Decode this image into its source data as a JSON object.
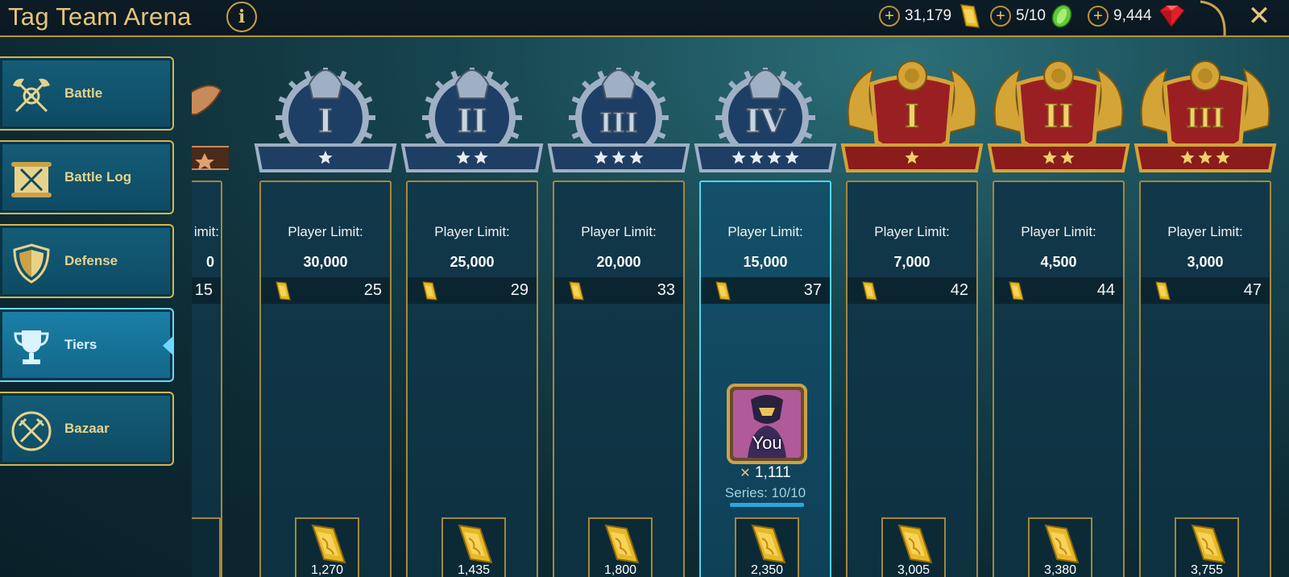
{
  "header": {
    "title": "Tag Team Arena",
    "info_icon": "info-icon",
    "close_icon": "close-icon"
  },
  "resources": [
    {
      "value": "31,179",
      "icon": "gold-bar-icon"
    },
    {
      "value": "5/10",
      "icon": "arena-token-icon"
    },
    {
      "value": "9,444",
      "icon": "gem-icon"
    }
  ],
  "sidebar": {
    "items": [
      {
        "label": "Battle",
        "icon": "crossed-axes-icon",
        "active": false
      },
      {
        "label": "Battle Log",
        "icon": "scroll-swords-icon",
        "active": false
      },
      {
        "label": "Defense",
        "icon": "shield-icon",
        "active": false
      },
      {
        "label": "Tiers",
        "icon": "trophy-icon",
        "active": true
      },
      {
        "label": "Bazaar",
        "icon": "crossed-swords-icon",
        "active": false
      }
    ]
  },
  "tiers": {
    "partial": {
      "label_tail": "imit:",
      "value_tail": "0",
      "medals": "15"
    },
    "columns": [
      {
        "label": "Player Limit:",
        "limit": "30,000",
        "medals": "25",
        "reward": "1,270",
        "rank": "I",
        "stars": 1,
        "tier": "silver",
        "current": false
      },
      {
        "label": "Player Limit:",
        "limit": "25,000",
        "medals": "29",
        "reward": "1,435",
        "rank": "II",
        "stars": 2,
        "tier": "silver",
        "current": false
      },
      {
        "label": "Player Limit:",
        "limit": "20,000",
        "medals": "33",
        "reward": "1,800",
        "rank": "III",
        "stars": 3,
        "tier": "silver",
        "current": false
      },
      {
        "label": "Player Limit:",
        "limit": "15,000",
        "medals": "37",
        "reward": "2,350",
        "rank": "IV",
        "stars": 4,
        "tier": "silver",
        "current": true
      },
      {
        "label": "Player Limit:",
        "limit": "7,000",
        "medals": "42",
        "reward": "3,005",
        "rank": "I",
        "stars": 1,
        "tier": "gold",
        "current": false
      },
      {
        "label": "Player Limit:",
        "limit": "4,500",
        "medals": "44",
        "reward": "3,380",
        "rank": "II",
        "stars": 2,
        "tier": "gold",
        "current": false
      },
      {
        "label": "Player Limit:",
        "limit": "3,000",
        "medals": "47",
        "reward": "3,755",
        "rank": "III",
        "stars": 3,
        "tier": "gold",
        "current": false
      }
    ]
  },
  "player": {
    "label": "You",
    "score": "1,111",
    "series": "Series: 10/10",
    "series_progress": 1.0
  },
  "colors": {
    "accent_gold": "#e6c47a",
    "border_gold": "#b8923a",
    "active_blue": "#4fd6f0",
    "silver_banner": "#1f3e63",
    "gold_banner": "#8a1c1c"
  }
}
